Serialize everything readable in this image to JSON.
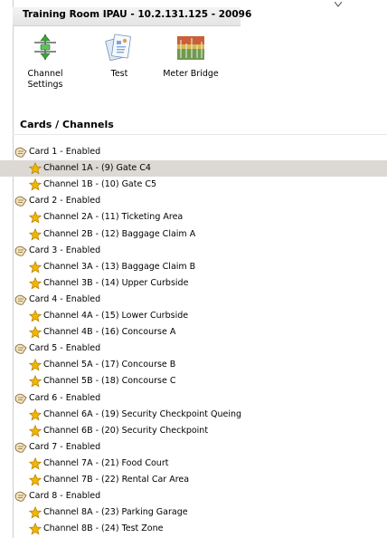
{
  "window": {
    "title": "Training Room IPAU - 10.2.131.125 - 20096"
  },
  "toolbar": {
    "items": [
      {
        "label": "Channel\nSettings",
        "icon": "channel-settings-icon"
      },
      {
        "label": "Test",
        "icon": "test-icon"
      },
      {
        "label": "Meter Bridge",
        "icon": "meter-bridge-icon"
      }
    ]
  },
  "tree": {
    "header": "Cards / Channels",
    "selected": "Channel 1A - (9) Gate C4",
    "cards": [
      {
        "label": "Card 1 - Enabled",
        "channels": [
          "Channel 1A - (9) Gate C4",
          "Channel 1B - (10) Gate C5"
        ]
      },
      {
        "label": "Card 2 - Enabled",
        "channels": [
          "Channel 2A - (11) Ticketing Area",
          "Channel 2B - (12) Baggage Claim A"
        ]
      },
      {
        "label": "Card 3 - Enabled",
        "channels": [
          "Channel 3A - (13) Baggage Claim B",
          "Channel 3B - (14) Upper Curbside"
        ]
      },
      {
        "label": "Card 4 - Enabled",
        "channels": [
          "Channel 4A - (15) Lower Curbside",
          "Channel 4B - (16) Concourse A"
        ]
      },
      {
        "label": "Card 5 - Enabled",
        "channels": [
          "Channel 5A - (17) Concourse B",
          "Channel 5B - (18) Concourse C"
        ]
      },
      {
        "label": "Card 6 - Enabled",
        "channels": [
          "Channel 6A - (19) Security Checkpoint Queing",
          "Channel 6B - (20) Security Checkpoint"
        ]
      },
      {
        "label": "Card 7 - Enabled",
        "channels": [
          "Channel 7A - (21) Food Court",
          "Channel 7B - (22) Rental Car Area"
        ]
      },
      {
        "label": "Card 8 - Enabled",
        "channels": [
          "Channel 8A - (23) Parking Garage",
          "Channel 8B - (24) Test Zone"
        ]
      }
    ]
  },
  "colors": {
    "selected_row": "#dcd9d4",
    "star": "#f2b600",
    "card_icon": "#b5935a"
  }
}
